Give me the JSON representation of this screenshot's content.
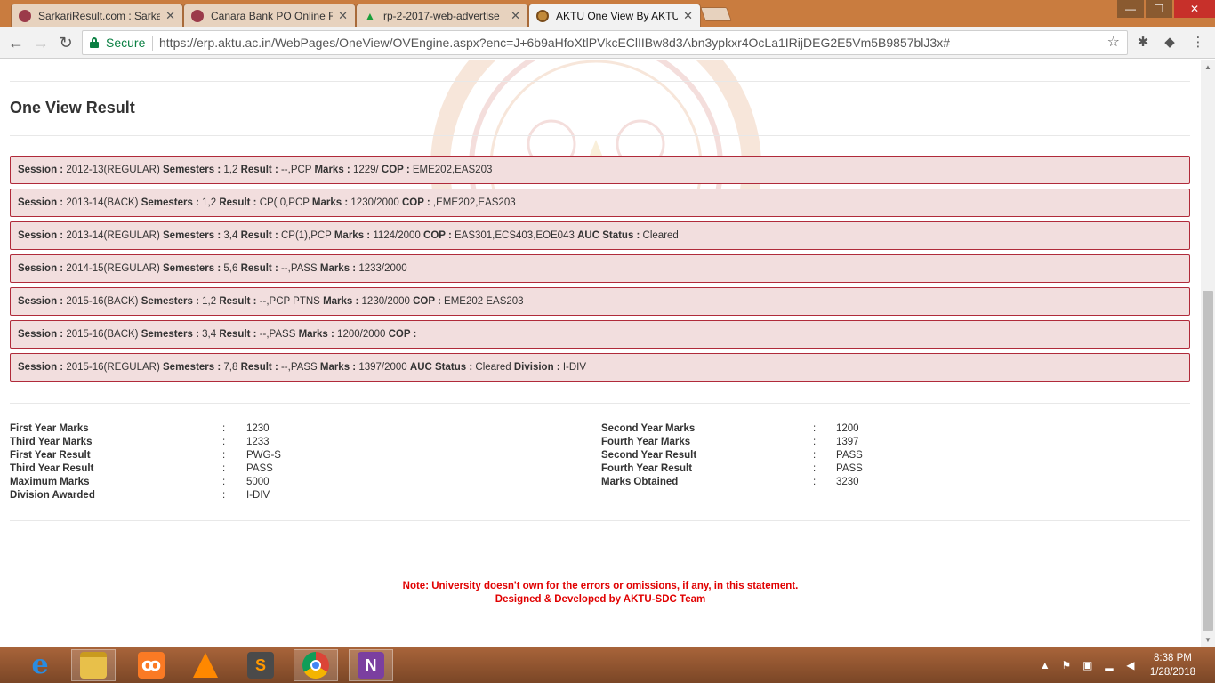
{
  "browser": {
    "tabs": [
      {
        "label": "SarkariResult.com : Sarka",
        "active": false
      },
      {
        "label": "Canara Bank PO Online F",
        "active": false
      },
      {
        "label": "rp-2-2017-web-advertise",
        "active": false
      },
      {
        "label": "AKTU One View By AKTU",
        "active": true
      }
    ],
    "secure_label": "Secure",
    "url": "https://erp.aktu.ac.in/WebPages/OneView/OVEngine.aspx?enc=J+6b9aHfoXtlPVkcEClIIBw8d3Abn3ypkxr4OcLa1IRijDEG2E5Vm5B9857blJ3x#"
  },
  "page": {
    "title": "One View Result",
    "sessions": [
      {
        "session_label": "Session :",
        "session": " 2012-13(REGULAR) ",
        "semesters_label": "Semesters :",
        "semesters": " 1,2 ",
        "result_label": "Result :",
        "result": " --,PCP ",
        "marks_label": "Marks :",
        "marks": " 1229/ ",
        "cop_label": "COP :",
        "cop": " EME202,EAS203"
      },
      {
        "session_label": "Session :",
        "session": " 2013-14(BACK) ",
        "semesters_label": "Semesters :",
        "semesters": " 1,2 ",
        "result_label": "Result :",
        "result": " CP( 0,PCP ",
        "marks_label": "Marks :",
        "marks": " 1230/2000 ",
        "cop_label": "COP :",
        "cop": " ,EME202,EAS203"
      },
      {
        "session_label": "Session :",
        "session": " 2013-14(REGULAR) ",
        "semesters_label": "Semesters :",
        "semesters": " 3,4 ",
        "result_label": "Result :",
        "result": " CP(1),PCP ",
        "marks_label": "Marks :",
        "marks": " 1124/2000 ",
        "cop_label": "COP :",
        "cop": " EAS301,ECS403,EOE043 ",
        "auc_label": "AUC Status :",
        "auc": " Cleared"
      },
      {
        "session_label": "Session :",
        "session": " 2014-15(REGULAR) ",
        "semesters_label": "Semesters :",
        "semesters": " 5,6 ",
        "result_label": "Result :",
        "result": " --,PASS ",
        "marks_label": "Marks :",
        "marks": " 1233/2000"
      },
      {
        "session_label": "Session :",
        "session": " 2015-16(BACK) ",
        "semesters_label": "Semesters :",
        "semesters": " 1,2 ",
        "result_label": "Result :",
        "result": " --,PCP PTNS ",
        "marks_label": "Marks :",
        "marks": " 1230/2000 ",
        "cop_label": "COP :",
        "cop": " EME202 EAS203"
      },
      {
        "session_label": "Session :",
        "session": " 2015-16(BACK) ",
        "semesters_label": "Semesters :",
        "semesters": " 3,4 ",
        "result_label": "Result :",
        "result": " --,PASS ",
        "marks_label": "Marks :",
        "marks": " 1200/2000 ",
        "cop_label": "COP :",
        "cop": ""
      },
      {
        "session_label": "Session :",
        "session": " 2015-16(REGULAR) ",
        "semesters_label": "Semesters :",
        "semesters": " 7,8 ",
        "result_label": "Result :",
        "result": " --,PASS ",
        "marks_label": "Marks :",
        "marks": " 1397/2000 ",
        "auc_label": "AUC Status :",
        "auc": " Cleared ",
        "division_label": "Division :",
        "division": " I-DIV"
      }
    ],
    "summary_left": [
      {
        "label": "First Year Marks",
        "value": "1230"
      },
      {
        "label": "Third Year Marks",
        "value": "1233"
      },
      {
        "label": "First Year Result",
        "value": "PWG-S"
      },
      {
        "label": "Third Year Result",
        "value": "PASS"
      },
      {
        "label": "Maximum Marks",
        "value": "5000"
      },
      {
        "label": "Division Awarded",
        "value": "I-DIV"
      }
    ],
    "summary_right": [
      {
        "label": "Second Year Marks",
        "value": "1200"
      },
      {
        "label": "Fourth Year Marks",
        "value": "1397"
      },
      {
        "label": "Second Year Result",
        "value": "PASS"
      },
      {
        "label": "Fourth Year Result",
        "value": "PASS"
      },
      {
        "label": "Marks Obtained",
        "value": "3230"
      }
    ],
    "colon": ":",
    "note": "Note: University doesn't own for the errors or omissions, if any, in this statement.",
    "credit": "Designed & Developed by AKTU-SDC Team"
  },
  "taskbar": {
    "apps": [
      "internet-explorer",
      "file-explorer",
      "xampp",
      "vlc",
      "sublime-text",
      "chrome",
      "onenote"
    ],
    "clock_time": "8:38 PM",
    "clock_date": "1/28/2018"
  },
  "colors": {
    "session_bg": "#f2dede",
    "session_border": "#b02a3a",
    "note": "#e00000",
    "secure": "#0b8043"
  }
}
